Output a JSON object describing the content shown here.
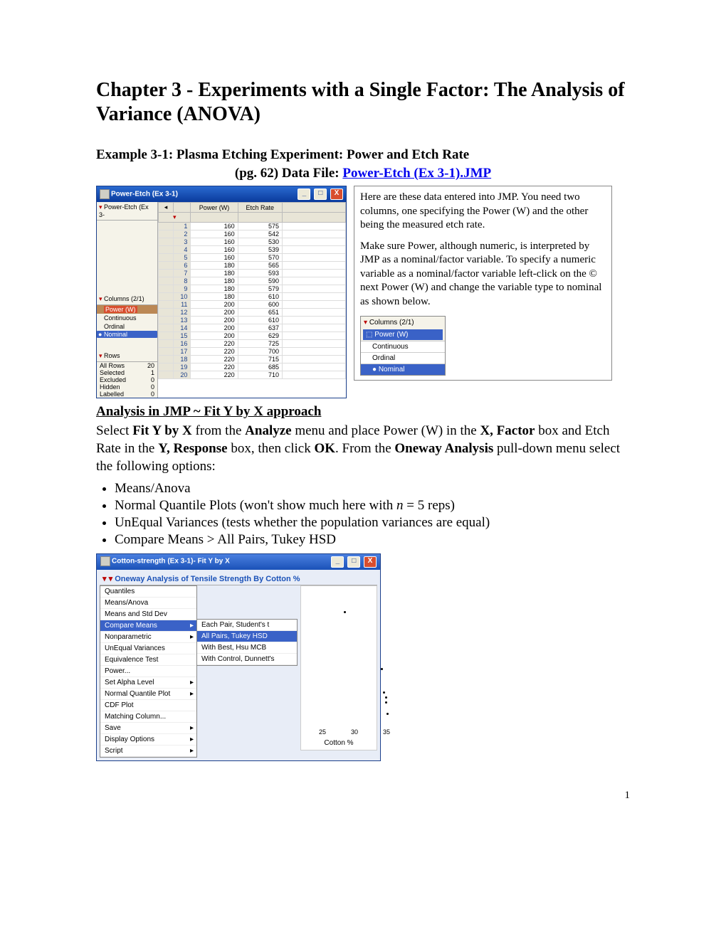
{
  "title": "Chapter 3 - Experiments with a Single Factor:  The Analysis of Variance (ANOVA)",
  "example_title": "Example 3-1:  Plasma Etching Experiment: Power and Etch Rate",
  "sub_pg": "(pg. 62)    Data File:  ",
  "datafile_link": "Power-Etch (Ex 3-1).JMP",
  "win1_title": "Power-Etch (Ex 3-1)",
  "left_panel_name": "Power-Etch (Ex 3-",
  "cols_label": "Columns (2/1)",
  "powerw": "Power (W)",
  "type_cont": "Continuous",
  "type_ord": "Ordinal",
  "type_nom": "Nominal",
  "rows_label": "Rows",
  "rows": {
    "All Rows": "20",
    "Selected": "1",
    "Excluded": "0",
    "Hidden": "0",
    "Labelled": "0"
  },
  "col_power": "Power (W)",
  "col_etch": "Etch Rate",
  "data": [
    [
      1,
      160,
      575
    ],
    [
      2,
      160,
      542
    ],
    [
      3,
      160,
      530
    ],
    [
      4,
      160,
      539
    ],
    [
      5,
      160,
      570
    ],
    [
      6,
      180,
      565
    ],
    [
      7,
      180,
      593
    ],
    [
      8,
      180,
      590
    ],
    [
      9,
      180,
      579
    ],
    [
      10,
      180,
      610
    ],
    [
      11,
      200,
      600
    ],
    [
      12,
      200,
      651
    ],
    [
      13,
      200,
      610
    ],
    [
      14,
      200,
      637
    ],
    [
      15,
      200,
      629
    ],
    [
      16,
      220,
      725
    ],
    [
      17,
      220,
      700
    ],
    [
      18,
      220,
      715
    ],
    [
      19,
      220,
      685
    ],
    [
      20,
      220,
      710
    ]
  ],
  "para1": "Here are these data entered into JMP.  You need two columns, one specifying the Power (W) and the other being the measured etch rate.",
  "para2": "Make sure Power, although numeric, is interpreted by JMP as a nominal/factor variable.  To specify a numeric variable as a nominal/factor variable left-click on the © next Power (W) and change the variable type to nominal as shown below.",
  "analysis_head": "Analysis in JMP ~ Fit Y by X approach",
  "analysis_p1a": "Select ",
  "analysis_p1b": "Fit Y by X",
  "analysis_p1c": " from the ",
  "analysis_p1d": "Analyze",
  "analysis_p1e": " menu and place Power (W) in the ",
  "analysis_p1f": "X, Factor",
  "analysis_p1g": " box and Etch Rate in the ",
  "analysis_p1h": "Y, Response",
  "analysis_p1i": " box, then click ",
  "analysis_p1j": "OK",
  "analysis_p1k": ".  From the ",
  "analysis_p1l": "Oneway Analysis",
  "analysis_p1m": " pull-down menu select the following options:",
  "opts": [
    "Means/Anova",
    "Normal Quantile Plots (won't show much here with n =  5 reps)",
    "UnEqual Variances (tests whether the population variances are equal)",
    "Compare Means > All Pairs, Tukey HSD"
  ],
  "fit_title": "Cotton-strength (Ex 3-1)- Fit Y by X",
  "oneway_head": "Oneway Analysis of Tensile Strength By Cotton %",
  "menu1": [
    "Quantiles",
    "Means/Anova",
    "Means and Std Dev",
    "Compare Means",
    "Nonparametric",
    "UnEqual Variances",
    "Equivalence Test",
    "Power...",
    "Set Alpha Level",
    "Normal Quantile Plot",
    "CDF Plot",
    "Matching Column...",
    "Save",
    "Display Options",
    "Script"
  ],
  "menu2": [
    "Each Pair, Student's t",
    "All Pairs, Tukey HSD",
    "With Best, Hsu MCB",
    "With Control, Dunnett's"
  ],
  "xaxis_label": "Cotton %",
  "xticks": [
    "25",
    "30",
    "35"
  ],
  "pagenum": "1"
}
